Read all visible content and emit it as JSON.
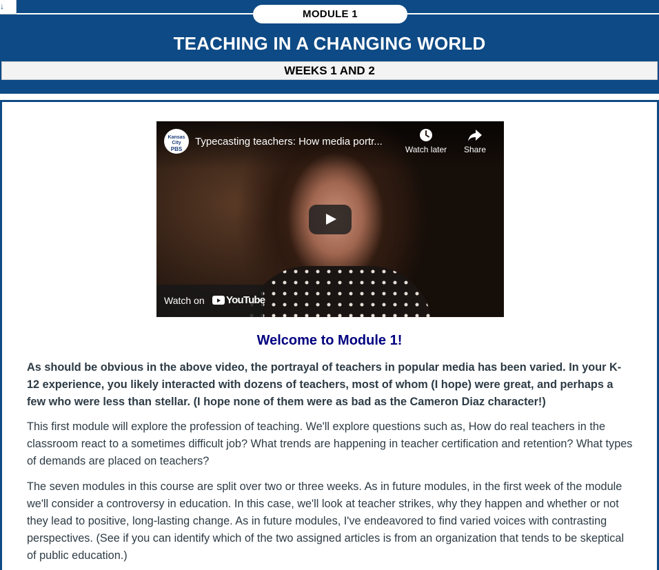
{
  "banner": {
    "corner_icon": "download-arrow-icon",
    "corner_glyph": "↓",
    "module_label": "MODULE 1",
    "title": "TEACHING IN A CHANGING WORLD",
    "weeks": "WEEKS 1 AND 2",
    "background_color": "#0e4a85"
  },
  "video": {
    "channel_logo_line1": "Kansas City",
    "channel_logo_line2": "PBS",
    "title": "Typecasting teachers: How media portr...",
    "watch_later_label": "Watch later",
    "share_label": "Share",
    "watch_on_label": "Watch on",
    "youtube_label": "YouTube",
    "icons": [
      "clock-icon",
      "share-arrow-icon",
      "play-icon",
      "youtube-logo-icon"
    ]
  },
  "content": {
    "welcome_heading": "Welcome to Module 1!",
    "heading_color": "#000080",
    "paragraphs": [
      "As should be obvious in the above video, the portrayal of teachers in popular media has been varied. In your K-12 experience, you likely interacted with dozens of teachers, most of whom (I hope) were great, and perhaps a few who were less than stellar. (I hope none of them were as bad as the Cameron Diaz character!)",
      "This first module will explore the profession of teaching. We'll explore questions such as, How do real teachers in the classroom react to a sometimes difficult job? What trends are happening in teacher certification and retention? What types of demands are placed on teachers?",
      "The seven modules in this course are split over two or three weeks. As in future modules, in the first week of the module we'll consider a controversy in education. In this case, we'll look at teacher strikes, why they happen and whether or not they lead to positive, long-lasting change. As in future modules, I've endeavored to find varied voices with contrasting perspectives. (See if you can identify which of the two assigned articles is from an organization that tends to be skeptical of public education.)"
    ]
  }
}
